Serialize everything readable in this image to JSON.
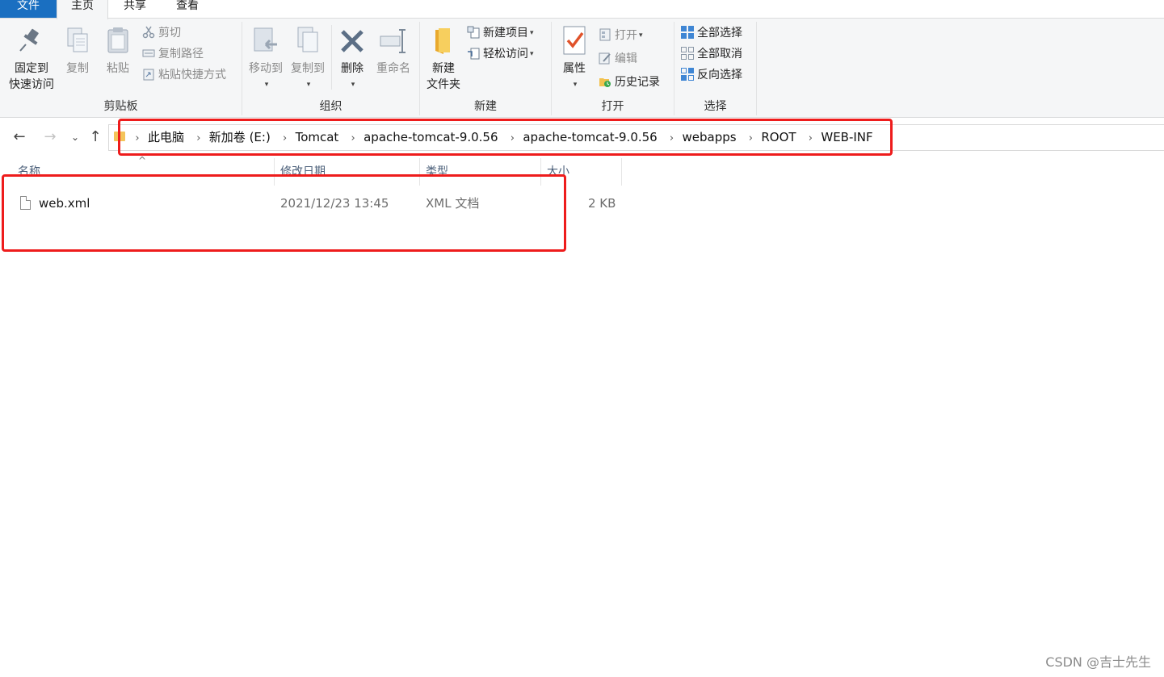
{
  "tabs": {
    "file": "文件",
    "home": "主页",
    "share": "共享",
    "view": "查看"
  },
  "ribbon": {
    "clipboard": {
      "label": "剪贴板",
      "pin_line1": "固定到",
      "pin_line2": "快速访问",
      "copy": "复制",
      "paste": "粘贴",
      "cut": "剪切",
      "copy_path": "复制路径",
      "paste_shortcut": "粘贴快捷方式"
    },
    "organize": {
      "label": "组织",
      "move_to": "移动到",
      "copy_to": "复制到",
      "delete": "删除",
      "rename": "重命名"
    },
    "new": {
      "label": "新建",
      "new_folder_line1": "新建",
      "new_folder_line2": "文件夹",
      "new_item": "新建项目",
      "easy_access": "轻松访问"
    },
    "open": {
      "label": "打开",
      "properties": "属性",
      "open": "打开",
      "edit": "编辑",
      "history": "历史记录"
    },
    "select": {
      "label": "选择",
      "select_all": "全部选择",
      "select_none": "全部取消",
      "invert": "反向选择"
    }
  },
  "nav": {
    "back_icon": "arrow-left",
    "forward_icon": "arrow-right",
    "recent_icon": "chevron-down",
    "up_icon": "arrow-up"
  },
  "breadcrumb": [
    "此电脑",
    "新加卷 (E:)",
    "Tomcat",
    "apache-tomcat-9.0.56",
    "apache-tomcat-9.0.56",
    "webapps",
    "ROOT",
    "WEB-INF"
  ],
  "columns": {
    "name": "名称",
    "modified": "修改日期",
    "type": "类型",
    "size": "大小"
  },
  "files": [
    {
      "name": "web.xml",
      "modified": "2021/12/23 13:45",
      "type": "XML 文档",
      "size": "2 KB"
    }
  ],
  "colors": {
    "file_tab": "#1a6fc1",
    "highlight": "#ee1c1c",
    "ribbon_bg": "#f5f6f7"
  },
  "watermark": "CSDN @吉士先生"
}
